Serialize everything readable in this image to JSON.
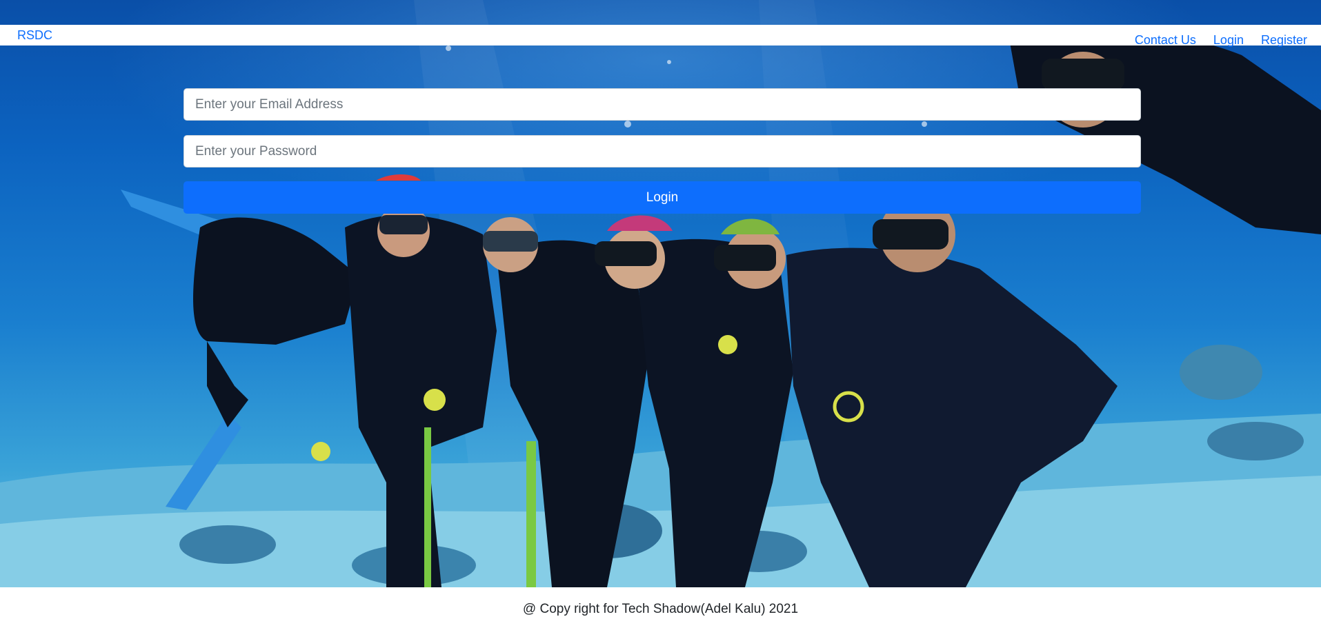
{
  "navbar": {
    "brand": "RSDC",
    "links": [
      {
        "label": "Contact Us"
      },
      {
        "label": "Login"
      },
      {
        "label": "Register"
      }
    ]
  },
  "login_form": {
    "email_placeholder": "Enter your Email Address",
    "email_value": "",
    "password_placeholder": "Enter your Password",
    "password_value": "",
    "submit_label": "Login"
  },
  "hero": {
    "image_alt": "Group of scuba divers posing underwater above a coral reef"
  },
  "footer": {
    "text": "@ Copy right for Tech Shadow(Adel Kalu) 2021"
  },
  "colors": {
    "primary": "#0d6efd",
    "text": "#212529",
    "water_deep": "#0a4fa8",
    "water_light": "#6fc3e4"
  }
}
